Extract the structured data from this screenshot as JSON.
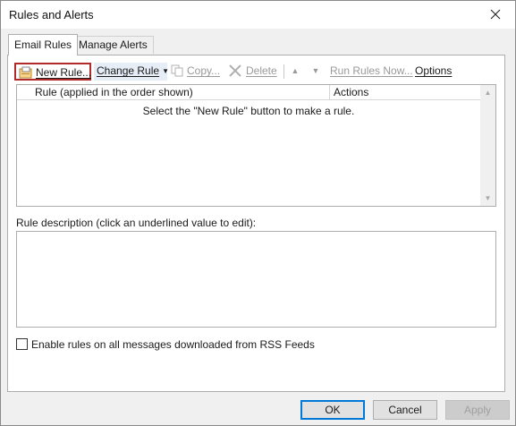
{
  "window": {
    "title": "Rules and Alerts"
  },
  "tabs": [
    {
      "label": "Email Rules",
      "active": true
    },
    {
      "label": "Manage Alerts",
      "active": false
    }
  ],
  "toolbar": {
    "new_rule": "New Rule...",
    "change_rule": "Change Rule",
    "copy": "Copy...",
    "delete": "Delete",
    "move_up": "▲",
    "move_down": "▼",
    "run_rules_now": "Run Rules Now...",
    "options": "Options"
  },
  "rules_list": {
    "columns": [
      "Rule (applied in the order shown)",
      "Actions"
    ],
    "empty_message": "Select the \"New Rule\" button to make a rule."
  },
  "description": {
    "label": "Rule description (click an underlined value to edit):"
  },
  "rss": {
    "label": "Enable rules on all messages downloaded from RSS Feeds",
    "checked": false
  },
  "buttons": {
    "ok": "OK",
    "cancel": "Cancel",
    "apply": "Apply"
  },
  "colors": {
    "highlight_border": "#b22b2b",
    "default_button_border": "#0078d7"
  }
}
